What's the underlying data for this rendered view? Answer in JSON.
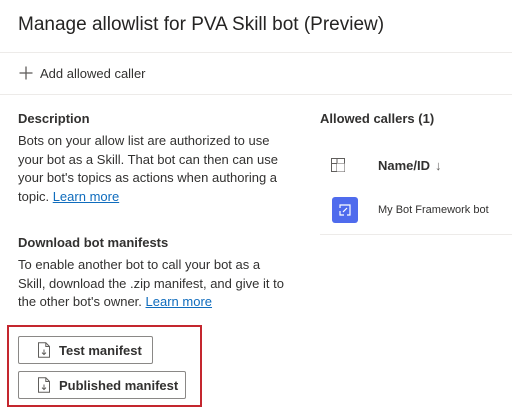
{
  "dialog": {
    "title": "Manage allowlist for PVA Skill bot (Preview)"
  },
  "toolbar": {
    "add_label": "Add allowed caller"
  },
  "description": {
    "heading": "Description",
    "text": "Bots on your allow list are authorized to use your bot as a Skill. That bot can then can use your bot's topics as actions when authoring a topic.",
    "link": "Learn more"
  },
  "download": {
    "heading": "Download bot manifests",
    "text": "To enable another bot to call your bot as a Skill, download the .zip manifest, and give it to the other bot's owner.",
    "link": "Learn more",
    "buttons": {
      "test_label": "Test manifest",
      "published_label": "Published manifest"
    }
  },
  "callers": {
    "heading": "Allowed callers (1)",
    "column_label": "Name/ID",
    "sort_glyph": "↓",
    "rows": [
      {
        "name": "My Bot Framework bot"
      }
    ]
  },
  "colors": {
    "accent": "#0f6cbd",
    "highlight": "#c4262e",
    "bot_avatar": "#4f6bed"
  },
  "icons": {
    "add": "plus-icon",
    "manifest": "document-download-icon",
    "column": "table-column-icon",
    "bot": "bot-icon"
  }
}
